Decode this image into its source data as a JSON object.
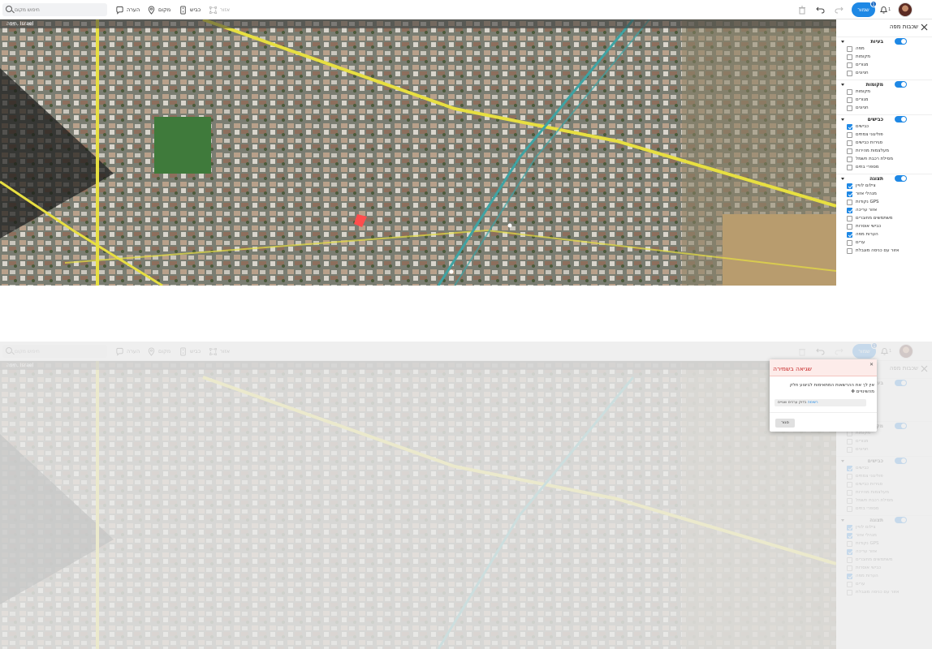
{
  "toolbar": {
    "search_placeholder": "חיפוש מקום",
    "tools": [
      {
        "label": "הערה",
        "icon": "comment-icon"
      },
      {
        "label": "מקום",
        "icon": "map-pin-icon"
      },
      {
        "label": "כביש",
        "icon": "road-icon"
      },
      {
        "label": "אזור",
        "icon": "area-icon"
      }
    ],
    "save_label": "שמור",
    "save_badge": "1",
    "notification_count": "1"
  },
  "map": {
    "location_label": "חיפה, Israel"
  },
  "layers_panel": {
    "title": "שכבות מפה",
    "sections": [
      {
        "title": "בעיות",
        "enabled": true,
        "items": [
          {
            "label": "מפה",
            "checked": false
          },
          {
            "label": "מקומות",
            "checked": false
          },
          {
            "label": "מגורים",
            "checked": false
          },
          {
            "label": "חניונים",
            "checked": false
          }
        ]
      },
      {
        "title": "מקומות",
        "enabled": true,
        "items": [
          {
            "label": "מקומות",
            "checked": false
          },
          {
            "label": "מגורים",
            "checked": false
          },
          {
            "label": "חניונים",
            "checked": false
          }
        ]
      },
      {
        "title": "כבישים",
        "enabled": true,
        "items": [
          {
            "label": "כבישים",
            "checked": true
          },
          {
            "label": "פוליגוני צמתים",
            "checked": false
          },
          {
            "label": "סגירות כבישים",
            "checked": false
          },
          {
            "label": "מעלצמות מהירות",
            "checked": false
          },
          {
            "label": "מסילת רכבת חשמל",
            "checked": false
          },
          {
            "label": "מספרי בתים",
            "checked": false
          }
        ]
      },
      {
        "title": "תצוגה",
        "enabled": true,
        "items": [
          {
            "label": "צילום לוויין",
            "checked": true
          },
          {
            "label": "מנהלי אזור",
            "checked": true
          },
          {
            "label": "נקודות GPS",
            "checked": false
          },
          {
            "label": "אזור עריכה",
            "checked": true
          },
          {
            "label": "משתמשים מחוברים",
            "checked": false
          },
          {
            "label": "כבישי אוסרות",
            "checked": false
          },
          {
            "label": "הערות מפה",
            "checked": true
          },
          {
            "label": "ערים",
            "checked": false
          },
          {
            "label": "אזור עם כניסה מוגבלת",
            "checked": false
          }
        ]
      }
    ]
  },
  "error_dialog": {
    "title": "שגיאה בשמירה",
    "message": "אין לך את ההרשאות המתאימות לביצוע חלק מהשינויים",
    "field_prefix": "רשימה",
    "field_text": "בדוק ערכים שגויים",
    "close_label": "סגור"
  },
  "colors": {
    "accent": "#1e88e5",
    "error_title": "#c62828",
    "error_header_bg": "#fdecea"
  }
}
